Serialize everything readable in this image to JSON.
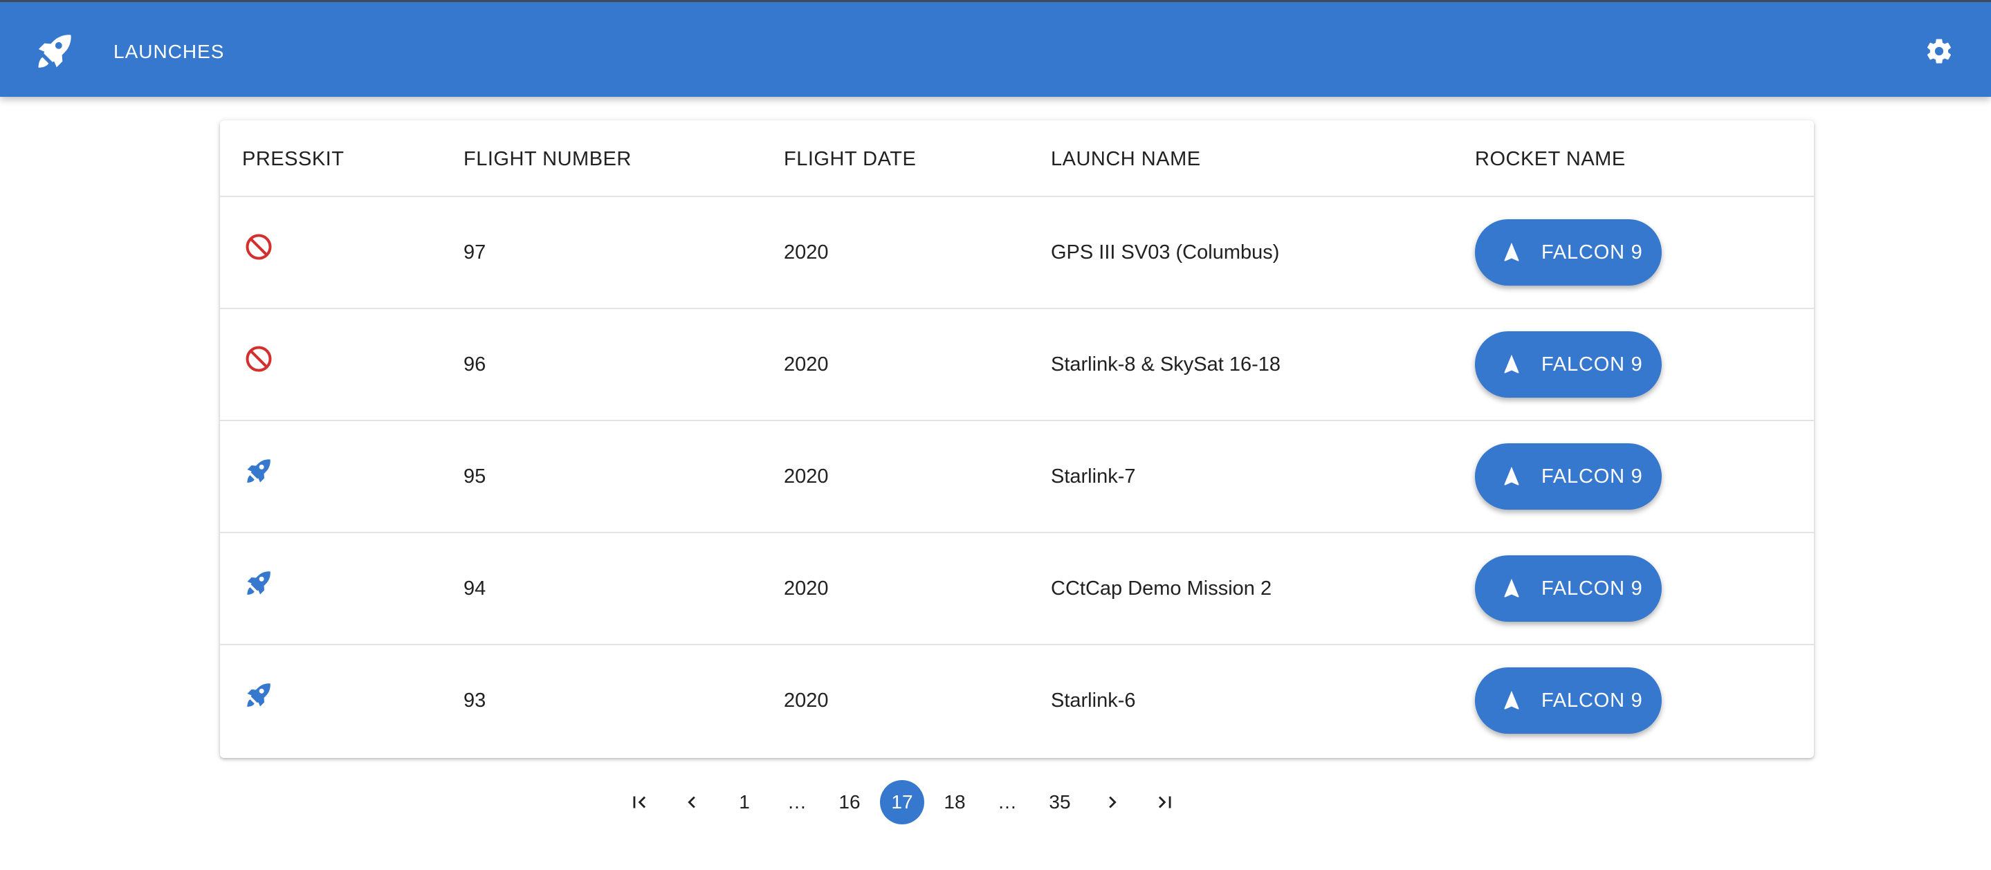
{
  "header": {
    "title": "LAUNCHES",
    "logo_icon": "rocket-icon",
    "settings_icon": "gear-icon",
    "color": "#3778cf"
  },
  "table": {
    "columns": [
      "PRESSKIT",
      "FLIGHT NUMBER",
      "FLIGHT DATE",
      "LAUNCH NAME",
      "ROCKET NAME"
    ],
    "rows": [
      {
        "presskit_icon": "block-icon",
        "presskit_available": false,
        "flight_number": "97",
        "flight_date": "2020",
        "launch_name": "GPS III SV03 (Columbus)",
        "rocket_name": "FALCON 9"
      },
      {
        "presskit_icon": "block-icon",
        "presskit_available": false,
        "flight_number": "96",
        "flight_date": "2020",
        "launch_name": "Starlink-8 & SkySat 16-18",
        "rocket_name": "FALCON 9"
      },
      {
        "presskit_icon": "rocket-icon",
        "presskit_available": true,
        "flight_number": "95",
        "flight_date": "2020",
        "launch_name": "Starlink-7",
        "rocket_name": "FALCON 9"
      },
      {
        "presskit_icon": "rocket-icon",
        "presskit_available": true,
        "flight_number": "94",
        "flight_date": "2020",
        "launch_name": "CCtCap Demo Mission 2",
        "rocket_name": "FALCON 9"
      },
      {
        "presskit_icon": "rocket-icon",
        "presskit_available": true,
        "flight_number": "93",
        "flight_date": "2020",
        "launch_name": "Starlink-6",
        "rocket_name": "FALCON 9"
      }
    ]
  },
  "pagination": {
    "first_icon": "first-page-icon",
    "prev_icon": "chevron-left-icon",
    "next_icon": "chevron-right-icon",
    "last_icon": "last-page-icon",
    "pages": [
      "1",
      "…",
      "16",
      "17",
      "18",
      "…",
      "35"
    ],
    "current": "17"
  },
  "colors": {
    "accent": "#3778cf",
    "block": "#d32f2f"
  }
}
